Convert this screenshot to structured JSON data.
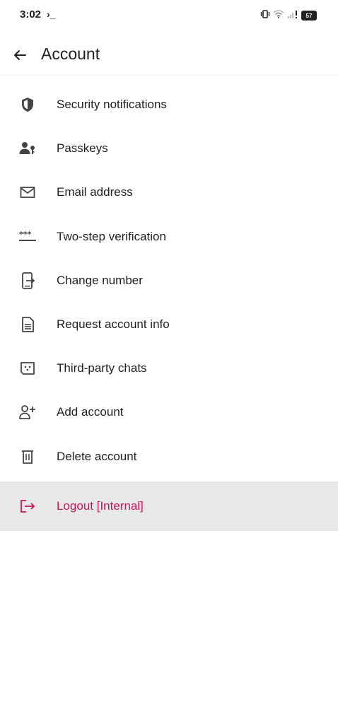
{
  "status_bar": {
    "time": "3:02",
    "prompt_glyph": "›_",
    "battery_level": "57",
    "icons": [
      "vibrate-icon",
      "wifi-icon",
      "signal-icon",
      "battery-icon"
    ]
  },
  "header": {
    "back_icon": "arrow-back-icon",
    "title": "Account"
  },
  "menu": {
    "items": [
      {
        "label": "Security notifications",
        "icon": "shield-icon"
      },
      {
        "label": "Passkeys",
        "icon": "person-key-icon"
      },
      {
        "label": "Email address",
        "icon": "mail-icon"
      },
      {
        "label": "Two-step verification",
        "icon": "password-dots-icon"
      },
      {
        "label": "Change number",
        "icon": "phone-transfer-icon"
      },
      {
        "label": "Request account info",
        "icon": "document-icon"
      },
      {
        "label": "Third-party chats",
        "icon": "chat-box-icon"
      },
      {
        "label": "Add account",
        "icon": "person-add-icon"
      },
      {
        "label": "Delete account",
        "icon": "trash-icon"
      }
    ],
    "logout": {
      "label": "Logout [Internal]",
      "icon": "logout-icon"
    }
  },
  "colors": {
    "logout_accent": "#c2185b",
    "highlight_background": "#e8e8e8",
    "icon_color": "#444444",
    "text_color": "#1f1f1f"
  }
}
